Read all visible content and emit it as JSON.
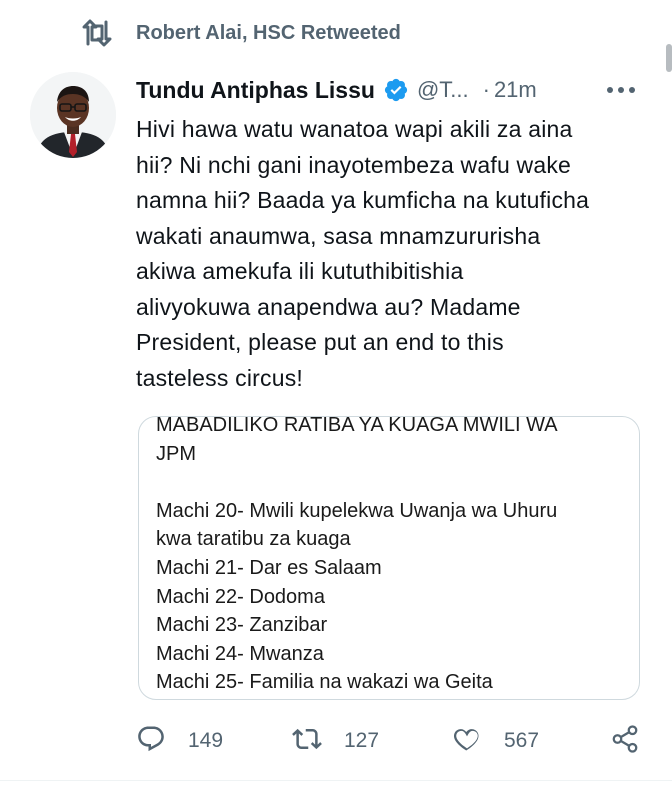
{
  "social_context": {
    "icon": "retweet-icon",
    "text": "Robert Alai, HSC Retweeted"
  },
  "author": {
    "display_name": "Tundu Antiphas Lissu",
    "verified_icon": "verified-badge-icon",
    "handle": "@T...",
    "separator": "·",
    "timestamp": "21m",
    "avatar_icon": "profile-photo"
  },
  "more_icon": "more-horizontal-icon",
  "tweet": {
    "text_lines": [
      "Hivi hawa watu wanatoa wapi akili za aina",
      "hii? Ni nchi gani inayotembeza wafu wake",
      "namna hii? Baada ya kumficha na kutuficha",
      "wakati anaumwa, sasa mnamzururisha",
      "akiwa amekufa ili kututhibitishia",
      "alivyokuwa anapendwa au? Madame",
      "President, please put an end to this",
      "tasteless circus!"
    ]
  },
  "media": {
    "title_lines": [
      "MABADILIKO RATIBA YA KUAGA MWILI WA",
      "JPM"
    ],
    "schedule_lines": [
      "Machi 20- Mwili kupelekwa Uwanja wa Uhuru",
      "kwa taratibu za kuaga",
      "Machi 21- Dar es Salaam",
      "Machi 22- Dodoma",
      "Machi 23- Zanzibar",
      "Machi 24- Mwanza",
      "Machi 25- Familia na wakazi wa Geita"
    ]
  },
  "actions": {
    "reply": {
      "icon": "reply-icon",
      "count": "149"
    },
    "retweet": {
      "icon": "retweet-icon",
      "count": "127"
    },
    "like": {
      "icon": "heart-icon",
      "count": "567"
    },
    "share": {
      "icon": "share-icon"
    }
  },
  "colors": {
    "primary_text": "#0f1419",
    "secondary_text": "#536471",
    "verified_blue": "#1d9bf0",
    "card_border": "#cfd9de"
  }
}
